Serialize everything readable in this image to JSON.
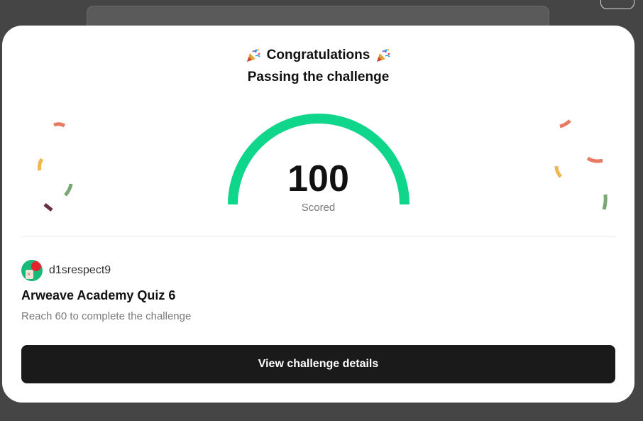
{
  "modal": {
    "heading": "Congratulations",
    "subheading": "Passing the challenge",
    "score": {
      "value": "100",
      "label": "Scored",
      "fill_fraction": 1.0,
      "color": "#0fd68a"
    },
    "user": {
      "name": "d1srespect9"
    },
    "challenge": {
      "title": "Arweave Academy Quiz 6",
      "requirement": "Reach 60 to complete the challenge"
    },
    "cta_label": "View challenge details"
  },
  "icons": {
    "heading_left": "party-popper-icon",
    "heading_right": "party-popper-icon"
  },
  "colors": {
    "backdrop": "#454545",
    "card": "#ffffff",
    "button": "#1a1a1a",
    "confetti": [
      "#e67a62",
      "#f0b74e",
      "#7aa872",
      "#6b2f45"
    ]
  }
}
